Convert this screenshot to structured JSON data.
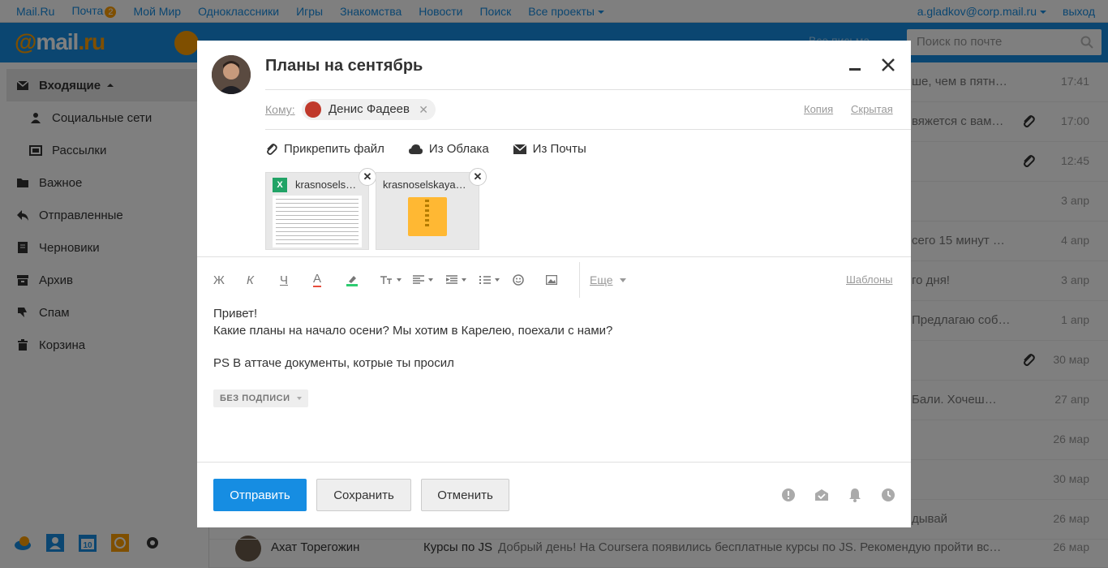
{
  "portal": {
    "links": [
      "Mail.Ru",
      "Почта",
      "Мой Мир",
      "Одноклассники",
      "Игры",
      "Знакомства",
      "Новости",
      "Поиск",
      "Все проекты"
    ],
    "mail_badge": "2",
    "user": "a.gladkov@corp.mail.ru",
    "logout": "выход"
  },
  "header": {
    "logo_at": "@",
    "logo_mail": "mail",
    "logo_ru": ".ru",
    "search_placeholder": "Поиск по почте",
    "partial_text": "Все письма"
  },
  "sidebar": {
    "items": [
      {
        "label": "Входящие",
        "icon": "inbox-icon"
      },
      {
        "label": "Социальные сети",
        "icon": "people-icon"
      },
      {
        "label": "Рассылки",
        "icon": "newsletter-icon"
      },
      {
        "label": "Важное",
        "icon": "folder-icon"
      },
      {
        "label": "Отправленные",
        "icon": "reply-icon"
      },
      {
        "label": "Черновики",
        "icon": "draft-icon"
      },
      {
        "label": "Архив",
        "icon": "archive-icon"
      },
      {
        "label": "Спам",
        "icon": "thumb-down-icon"
      },
      {
        "label": "Корзина",
        "icon": "trash-icon"
      }
    ],
    "bottom_icons": [
      "cloud-icon",
      "contacts-icon",
      "calendar-icon",
      "apps-icon",
      "settings-icon"
    ]
  },
  "mail_list": {
    "rows": [
      {
        "snippet": "ше, чем в пятн…",
        "date": "17:41",
        "attachment": false
      },
      {
        "snippet": "вяжется с вам…",
        "date": "17:00",
        "attachment": true
      },
      {
        "snippet": "",
        "date": "12:45",
        "attachment": true
      },
      {
        "snippet": "",
        "date": "3 апр",
        "attachment": false
      },
      {
        "snippet": "сего 15 минут …",
        "date": "4 апр",
        "attachment": false
      },
      {
        "snippet": "го дня!",
        "date": "3 апр",
        "attachment": false
      },
      {
        "snippet": "Предлагаю соб…",
        "date": "1 апр",
        "attachment": false
      },
      {
        "snippet": "",
        "date": "30 мар",
        "attachment": true
      },
      {
        "snippet": "Бали. Хочеш…",
        "date": "27 апр",
        "attachment": false
      },
      {
        "snippet": "",
        "date": "26 мар",
        "attachment": false
      },
      {
        "snippet": "",
        "date": "30 мар",
        "attachment": false
      },
      {
        "snippet": "дывай",
        "date": "26 мар",
        "attachment": false
      }
    ],
    "last_row": {
      "from": "Ахат Торегожин",
      "subject": "Курсы по JS",
      "snippet": "Добрый день! На Coursera появились бесплатные курсы по JS. Рекомендую пройти вс…",
      "date": "26 мар"
    }
  },
  "compose": {
    "title": "Планы на сентябрь",
    "to_label": "Кому:",
    "recipient": "Денис Фадеев",
    "cc": "Копия",
    "bcc": "Скрытая",
    "attach_file": "Прикрепить файл",
    "from_cloud": "Из Облака",
    "from_mail": "Из Почты",
    "files": [
      {
        "name": "krasnosels…",
        "type": "xls"
      },
      {
        "name": "krasnoselskaya…",
        "type": "zip"
      }
    ],
    "toolbar": {
      "bold": "Ж",
      "italic": "К",
      "underline": "Ч",
      "text_color": "А",
      "more": "Еще",
      "templates": "Шаблоны"
    },
    "body": [
      "Привет!",
      "Какие планы на начало осени? Мы хотим в Карелею, поехали с нами?",
      "",
      "PS В аттаче документы, котрые ты просил"
    ],
    "signature": "БЕЗ ПОДПИСИ",
    "send": "Отправить",
    "save": "Сохранить",
    "cancel": "Отменить",
    "footer_icons": [
      "important-icon",
      "receipt-icon",
      "notify-icon",
      "schedule-icon"
    ]
  },
  "colors": {
    "brand_blue": "#168de2",
    "brand_orange": "#ff9e00"
  }
}
